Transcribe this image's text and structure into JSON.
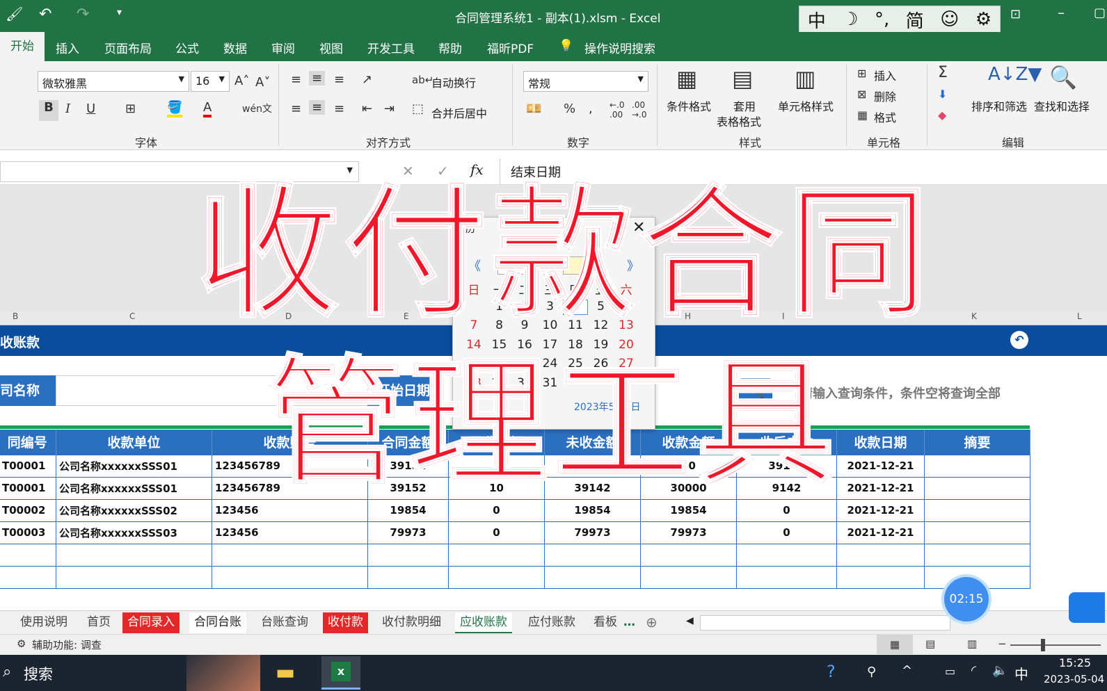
{
  "window": {
    "title": "合同管理系统1 - 副本(1).xlsm  -  Excel"
  },
  "ime": {
    "items": [
      "中",
      "☽",
      "°,",
      "简",
      "☺",
      "⚙"
    ]
  },
  "ribbon_tabs": [
    "开始",
    "插入",
    "页面布局",
    "公式",
    "数据",
    "审阅",
    "视图",
    "开发工具",
    "帮助",
    "福昕PDF",
    "操作说明搜索"
  ],
  "ribbon": {
    "font_name": "微软雅黑",
    "font_size": "16",
    "wrap_text": "自动换行",
    "merge_center": "合并后居中",
    "number_format": "常规",
    "cond_format": "条件格式",
    "table_format_1": "套用",
    "table_format_2": "表格格式",
    "cell_style": "单元格样式",
    "insert": "插入",
    "delete": "删除",
    "format": "格式",
    "sort_filter": "排序和筛选",
    "find_select": "查找和选择",
    "groups": {
      "font": "字体",
      "align": "对齐方式",
      "number": "数字",
      "styles": "样式",
      "cells": "单元格",
      "edit": "编辑"
    }
  },
  "formula_bar": {
    "content": "结束日期",
    "fx": "fx"
  },
  "columns": [
    "B",
    "C",
    "D",
    "E",
    "H",
    "I",
    "K",
    "L"
  ],
  "sheet": {
    "title": "收账款",
    "query": {
      "name_label": "司名称",
      "start_label": "开始日期",
      "hint": "请输入查询条件，条件空将查询全部"
    },
    "headers": [
      "同编号",
      "收款单位",
      "收款账号",
      "合同金额",
      "已收金额",
      "未收金额",
      "收款金额",
      "收后未收",
      "收款日期",
      "摘要"
    ],
    "rows": [
      [
        "T00001",
        "公司名称xxxxxxSSS01",
        "123456789",
        "39152",
        "0",
        "39152",
        "10",
        "39142",
        "2021-12-21",
        ""
      ],
      [
        "T00001",
        "公司名称xxxxxxSSS01",
        "123456789",
        "39152",
        "10",
        "39142",
        "30000",
        "9142",
        "2021-12-21",
        ""
      ],
      [
        "T00002",
        "公司名称xxxxxxSSS02",
        "123456",
        "19854",
        "0",
        "19854",
        "19854",
        "0",
        "2021-12-21",
        ""
      ],
      [
        "T00003",
        "公司名称xxxxxxSSS03",
        "123456",
        "79973",
        "0",
        "79973",
        "79973",
        "0",
        "2021-12-21",
        ""
      ]
    ]
  },
  "calendar": {
    "title": "历",
    "year": "2023",
    "year_label": "年",
    "month_label": "月",
    "prev": "《",
    "next": "》",
    "weekdays": [
      "日",
      "一",
      "二",
      "三",
      "四",
      "五",
      "六"
    ],
    "weeks": [
      [
        "",
        "1",
        "2",
        "3",
        "4",
        "5",
        "6"
      ],
      [
        "7",
        "8",
        "9",
        "10",
        "11",
        "12",
        "13"
      ],
      [
        "14",
        "15",
        "16",
        "17",
        "18",
        "19",
        "20"
      ],
      [
        "21",
        "22",
        "23",
        "24",
        "25",
        "26",
        "27"
      ],
      [
        "28",
        "29",
        "30",
        "31",
        "",
        "",
        ""
      ]
    ],
    "today": "2023年5月4日"
  },
  "overlay": {
    "line1": "收付款合同",
    "line2": "管理工具"
  },
  "sheet_tabs": [
    {
      "label": "使用说明",
      "style": "normal"
    },
    {
      "label": "首页",
      "style": "normal"
    },
    {
      "label": "合同录入",
      "style": "red"
    },
    {
      "label": "合同台账",
      "style": "white"
    },
    {
      "label": "台账查询",
      "style": "normal"
    },
    {
      "label": "收付款",
      "style": "red"
    },
    {
      "label": "收付款明细",
      "style": "normal"
    },
    {
      "label": "应收账款",
      "style": "active"
    },
    {
      "label": "应付账款",
      "style": "normal"
    },
    {
      "label": "看板",
      "style": "normal"
    }
  ],
  "status": {
    "accessibility": "辅助功能: 调查"
  },
  "timer": "02:15",
  "taskbar": {
    "search": "搜索",
    "ime": "中",
    "time": "15:25",
    "date": "2023-05-04"
  }
}
